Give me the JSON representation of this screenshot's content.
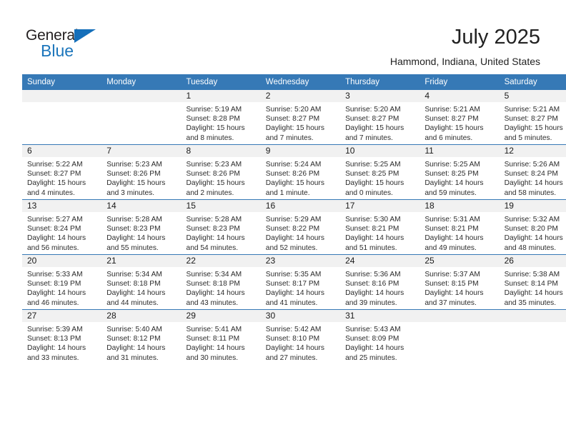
{
  "brand": {
    "name_top": "General",
    "name_bottom": "Blue",
    "triangle_color": "#156fba",
    "text_color_top": "#231f20",
    "text_color_bottom": "#1b75bb"
  },
  "header": {
    "title": "July 2025",
    "subtitle": "Hammond, Indiana, United States"
  },
  "theme": {
    "header_row_bg": "#3679b6",
    "header_row_text": "#ffffff",
    "daynum_bg": "#f1f1f1",
    "cell_bg": "#ffffff",
    "row_divider": "#3679b6"
  },
  "weekdays": [
    "Sunday",
    "Monday",
    "Tuesday",
    "Wednesday",
    "Thursday",
    "Friday",
    "Saturday"
  ],
  "weeks": [
    [
      {
        "day": "",
        "sunrise": "",
        "sunset": "",
        "daylight": "",
        "daylight2": "",
        "empty": true
      },
      {
        "day": "",
        "sunrise": "",
        "sunset": "",
        "daylight": "",
        "daylight2": "",
        "empty": true
      },
      {
        "day": "1",
        "sunrise": "Sunrise: 5:19 AM",
        "sunset": "Sunset: 8:28 PM",
        "daylight": "Daylight: 15 hours",
        "daylight2": "and 8 minutes."
      },
      {
        "day": "2",
        "sunrise": "Sunrise: 5:20 AM",
        "sunset": "Sunset: 8:27 PM",
        "daylight": "Daylight: 15 hours",
        "daylight2": "and 7 minutes."
      },
      {
        "day": "3",
        "sunrise": "Sunrise: 5:20 AM",
        "sunset": "Sunset: 8:27 PM",
        "daylight": "Daylight: 15 hours",
        "daylight2": "and 7 minutes."
      },
      {
        "day": "4",
        "sunrise": "Sunrise: 5:21 AM",
        "sunset": "Sunset: 8:27 PM",
        "daylight": "Daylight: 15 hours",
        "daylight2": "and 6 minutes."
      },
      {
        "day": "5",
        "sunrise": "Sunrise: 5:21 AM",
        "sunset": "Sunset: 8:27 PM",
        "daylight": "Daylight: 15 hours",
        "daylight2": "and 5 minutes."
      }
    ],
    [
      {
        "day": "6",
        "sunrise": "Sunrise: 5:22 AM",
        "sunset": "Sunset: 8:27 PM",
        "daylight": "Daylight: 15 hours",
        "daylight2": "and 4 minutes."
      },
      {
        "day": "7",
        "sunrise": "Sunrise: 5:23 AM",
        "sunset": "Sunset: 8:26 PM",
        "daylight": "Daylight: 15 hours",
        "daylight2": "and 3 minutes."
      },
      {
        "day": "8",
        "sunrise": "Sunrise: 5:23 AM",
        "sunset": "Sunset: 8:26 PM",
        "daylight": "Daylight: 15 hours",
        "daylight2": "and 2 minutes."
      },
      {
        "day": "9",
        "sunrise": "Sunrise: 5:24 AM",
        "sunset": "Sunset: 8:26 PM",
        "daylight": "Daylight: 15 hours",
        "daylight2": "and 1 minute."
      },
      {
        "day": "10",
        "sunrise": "Sunrise: 5:25 AM",
        "sunset": "Sunset: 8:25 PM",
        "daylight": "Daylight: 15 hours",
        "daylight2": "and 0 minutes."
      },
      {
        "day": "11",
        "sunrise": "Sunrise: 5:25 AM",
        "sunset": "Sunset: 8:25 PM",
        "daylight": "Daylight: 14 hours",
        "daylight2": "and 59 minutes."
      },
      {
        "day": "12",
        "sunrise": "Sunrise: 5:26 AM",
        "sunset": "Sunset: 8:24 PM",
        "daylight": "Daylight: 14 hours",
        "daylight2": "and 58 minutes."
      }
    ],
    [
      {
        "day": "13",
        "sunrise": "Sunrise: 5:27 AM",
        "sunset": "Sunset: 8:24 PM",
        "daylight": "Daylight: 14 hours",
        "daylight2": "and 56 minutes."
      },
      {
        "day": "14",
        "sunrise": "Sunrise: 5:28 AM",
        "sunset": "Sunset: 8:23 PM",
        "daylight": "Daylight: 14 hours",
        "daylight2": "and 55 minutes."
      },
      {
        "day": "15",
        "sunrise": "Sunrise: 5:28 AM",
        "sunset": "Sunset: 8:23 PM",
        "daylight": "Daylight: 14 hours",
        "daylight2": "and 54 minutes."
      },
      {
        "day": "16",
        "sunrise": "Sunrise: 5:29 AM",
        "sunset": "Sunset: 8:22 PM",
        "daylight": "Daylight: 14 hours",
        "daylight2": "and 52 minutes."
      },
      {
        "day": "17",
        "sunrise": "Sunrise: 5:30 AM",
        "sunset": "Sunset: 8:21 PM",
        "daylight": "Daylight: 14 hours",
        "daylight2": "and 51 minutes."
      },
      {
        "day": "18",
        "sunrise": "Sunrise: 5:31 AM",
        "sunset": "Sunset: 8:21 PM",
        "daylight": "Daylight: 14 hours",
        "daylight2": "and 49 minutes."
      },
      {
        "day": "19",
        "sunrise": "Sunrise: 5:32 AM",
        "sunset": "Sunset: 8:20 PM",
        "daylight": "Daylight: 14 hours",
        "daylight2": "and 48 minutes."
      }
    ],
    [
      {
        "day": "20",
        "sunrise": "Sunrise: 5:33 AM",
        "sunset": "Sunset: 8:19 PM",
        "daylight": "Daylight: 14 hours",
        "daylight2": "and 46 minutes."
      },
      {
        "day": "21",
        "sunrise": "Sunrise: 5:34 AM",
        "sunset": "Sunset: 8:18 PM",
        "daylight": "Daylight: 14 hours",
        "daylight2": "and 44 minutes."
      },
      {
        "day": "22",
        "sunrise": "Sunrise: 5:34 AM",
        "sunset": "Sunset: 8:18 PM",
        "daylight": "Daylight: 14 hours",
        "daylight2": "and 43 minutes."
      },
      {
        "day": "23",
        "sunrise": "Sunrise: 5:35 AM",
        "sunset": "Sunset: 8:17 PM",
        "daylight": "Daylight: 14 hours",
        "daylight2": "and 41 minutes."
      },
      {
        "day": "24",
        "sunrise": "Sunrise: 5:36 AM",
        "sunset": "Sunset: 8:16 PM",
        "daylight": "Daylight: 14 hours",
        "daylight2": "and 39 minutes."
      },
      {
        "day": "25",
        "sunrise": "Sunrise: 5:37 AM",
        "sunset": "Sunset: 8:15 PM",
        "daylight": "Daylight: 14 hours",
        "daylight2": "and 37 minutes."
      },
      {
        "day": "26",
        "sunrise": "Sunrise: 5:38 AM",
        "sunset": "Sunset: 8:14 PM",
        "daylight": "Daylight: 14 hours",
        "daylight2": "and 35 minutes."
      }
    ],
    [
      {
        "day": "27",
        "sunrise": "Sunrise: 5:39 AM",
        "sunset": "Sunset: 8:13 PM",
        "daylight": "Daylight: 14 hours",
        "daylight2": "and 33 minutes."
      },
      {
        "day": "28",
        "sunrise": "Sunrise: 5:40 AM",
        "sunset": "Sunset: 8:12 PM",
        "daylight": "Daylight: 14 hours",
        "daylight2": "and 31 minutes."
      },
      {
        "day": "29",
        "sunrise": "Sunrise: 5:41 AM",
        "sunset": "Sunset: 8:11 PM",
        "daylight": "Daylight: 14 hours",
        "daylight2": "and 30 minutes."
      },
      {
        "day": "30",
        "sunrise": "Sunrise: 5:42 AM",
        "sunset": "Sunset: 8:10 PM",
        "daylight": "Daylight: 14 hours",
        "daylight2": "and 27 minutes."
      },
      {
        "day": "31",
        "sunrise": "Sunrise: 5:43 AM",
        "sunset": "Sunset: 8:09 PM",
        "daylight": "Daylight: 14 hours",
        "daylight2": "and 25 minutes."
      },
      {
        "day": "",
        "sunrise": "",
        "sunset": "",
        "daylight": "",
        "daylight2": "",
        "empty": true
      },
      {
        "day": "",
        "sunrise": "",
        "sunset": "",
        "daylight": "",
        "daylight2": "",
        "empty": true
      }
    ]
  ]
}
